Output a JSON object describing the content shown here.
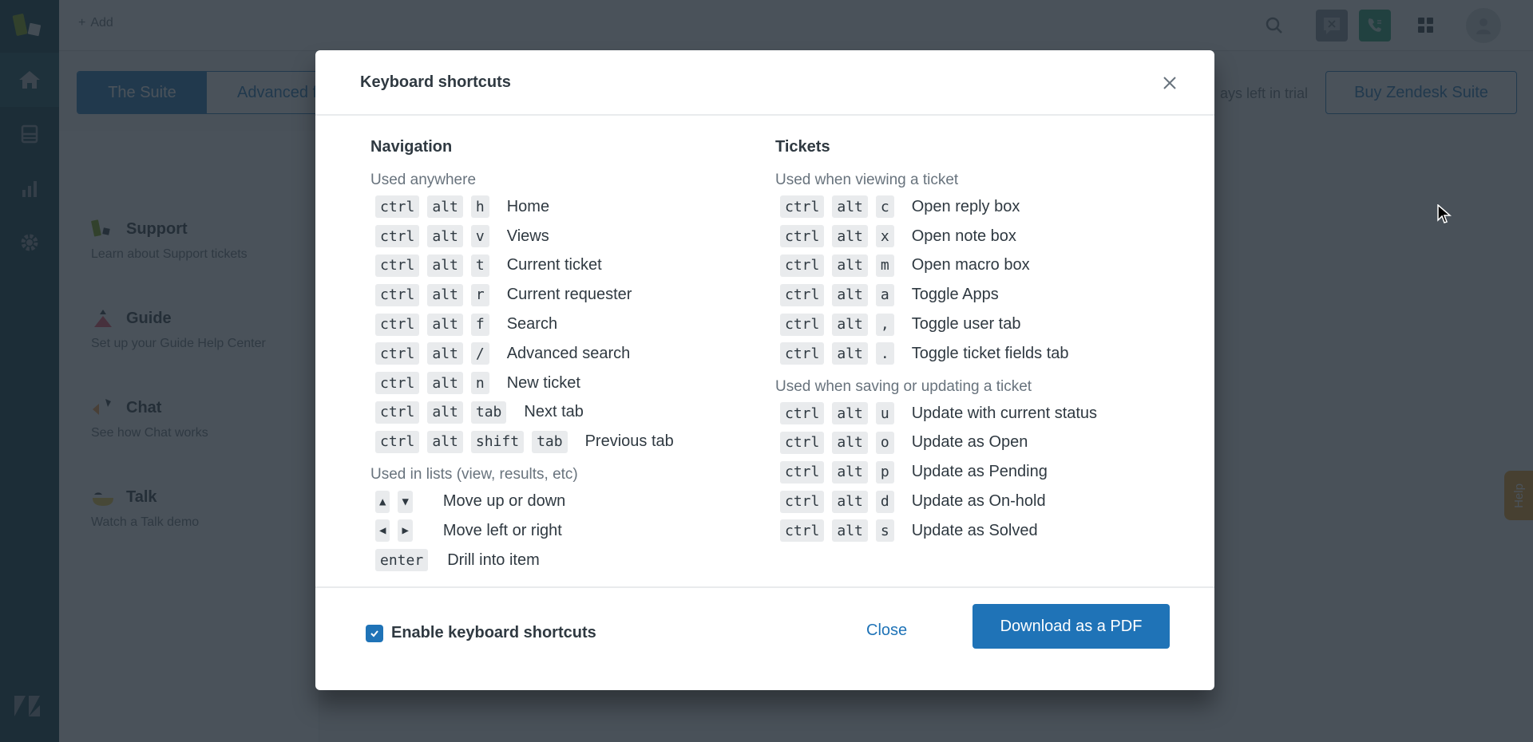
{
  "app": {
    "topbar": {
      "add_label": "Add",
      "icons": [
        "search-icon",
        "chat-status-icon",
        "talk-status-icon",
        "product-tray-icon",
        "user-avatar"
      ]
    },
    "nav_rail": [
      "zendesk-logo",
      "home-icon",
      "views-icon",
      "reporting-icon",
      "admin-gear-icon",
      "zendesk-z-logo"
    ],
    "segments": [
      "The Suite",
      "Advanced f"
    ],
    "trial_text": "ays left in trial",
    "buy_button": "Buy Zendesk Suite",
    "products": [
      {
        "name": "Support",
        "desc": "Learn about Support tickets"
      },
      {
        "name": "Guide",
        "desc": "Set up your Guide Help Center"
      },
      {
        "name": "Chat",
        "desc": "See how Chat works"
      },
      {
        "name": "Talk",
        "desc": "Watch a Talk demo"
      }
    ],
    "help_tab": "Help",
    "colors": {
      "brand_blue": "#1f73b7",
      "nav_dark": "#03363d",
      "help_orange": "#ef9c1e",
      "talk_green": "#1f9e6e"
    }
  },
  "modal": {
    "title": "Keyboard shortcuts",
    "navigation": {
      "title": "Navigation",
      "anywhere": {
        "label": "Used anywhere",
        "rows": [
          {
            "keys": [
              "ctrl",
              "alt",
              "h"
            ],
            "action": "Home"
          },
          {
            "keys": [
              "ctrl",
              "alt",
              "v"
            ],
            "action": "Views"
          },
          {
            "keys": [
              "ctrl",
              "alt",
              "t"
            ],
            "action": "Current ticket"
          },
          {
            "keys": [
              "ctrl",
              "alt",
              "r"
            ],
            "action": "Current requester"
          },
          {
            "keys": [
              "ctrl",
              "alt",
              "f"
            ],
            "action": "Search"
          },
          {
            "keys": [
              "ctrl",
              "alt",
              "/"
            ],
            "action": "Advanced search"
          },
          {
            "keys": [
              "ctrl",
              "alt",
              "n"
            ],
            "action": "New ticket"
          },
          {
            "keys": [
              "ctrl",
              "alt",
              "tab"
            ],
            "action": "Next tab"
          },
          {
            "keys": [
              "ctrl",
              "alt",
              "shift",
              "tab"
            ],
            "action": "Previous tab"
          }
        ]
      },
      "lists": {
        "label": "Used in lists (view, results, etc)",
        "rows": [
          {
            "keys": [
              "▲",
              "▼"
            ],
            "action": "Move up or down"
          },
          {
            "keys": [
              "◀",
              "▶"
            ],
            "action": "Move left or right"
          },
          {
            "keys": [
              "enter"
            ],
            "action": "Drill into item"
          }
        ]
      }
    },
    "tickets": {
      "title": "Tickets",
      "viewing": {
        "label": "Used when viewing a ticket",
        "rows": [
          {
            "keys": [
              "ctrl",
              "alt",
              "c"
            ],
            "action": "Open reply box"
          },
          {
            "keys": [
              "ctrl",
              "alt",
              "x"
            ],
            "action": "Open note box"
          },
          {
            "keys": [
              "ctrl",
              "alt",
              "m"
            ],
            "action": "Open macro box"
          },
          {
            "keys": [
              "ctrl",
              "alt",
              "a"
            ],
            "action": "Toggle Apps"
          },
          {
            "keys": [
              "ctrl",
              "alt",
              ","
            ],
            "action": "Toggle user tab"
          },
          {
            "keys": [
              "ctrl",
              "alt",
              "."
            ],
            "action": "Toggle ticket fields tab"
          }
        ]
      },
      "saving": {
        "label": "Used when saving or updating a ticket",
        "rows": [
          {
            "keys": [
              "ctrl",
              "alt",
              "u"
            ],
            "action": "Update with current status"
          },
          {
            "keys": [
              "ctrl",
              "alt",
              "o"
            ],
            "action": "Update as Open"
          },
          {
            "keys": [
              "ctrl",
              "alt",
              "p"
            ],
            "action": "Update as Pending"
          },
          {
            "keys": [
              "ctrl",
              "alt",
              "d"
            ],
            "action": "Update as On-hold"
          },
          {
            "keys": [
              "ctrl",
              "alt",
              "s"
            ],
            "action": "Update as Solved"
          }
        ]
      }
    },
    "footer": {
      "checkbox_label": "Enable keyboard shortcuts",
      "checkbox_checked": true,
      "close_label": "Close",
      "download_label": "Download as a PDF"
    }
  }
}
